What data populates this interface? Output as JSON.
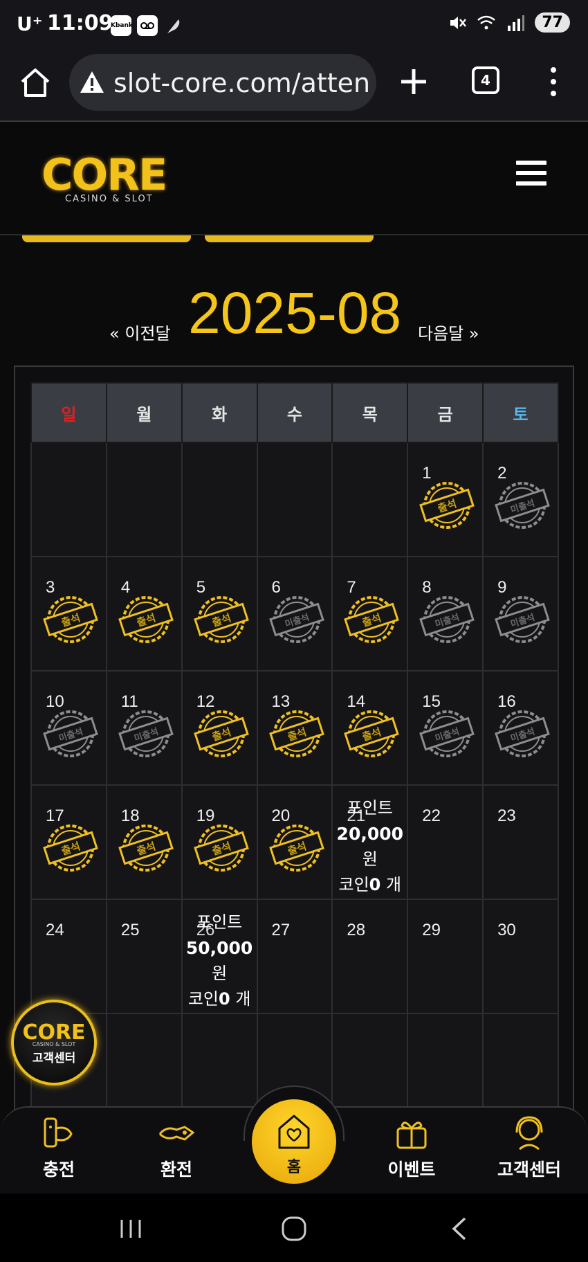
{
  "status_bar": {
    "carrier": "U⁺",
    "time": "11:09",
    "app_icon_1": "Kbank",
    "app_icon_2": "voicemail-icon",
    "app_icon_3": "feather-icon",
    "battery": "77"
  },
  "browser": {
    "url": "slot-core.com/attenda",
    "tab_count": "4"
  },
  "site": {
    "logo_text": "CORE",
    "logo_sub": "CASINO & SLOT"
  },
  "calendar": {
    "prev_label": "« 이전달",
    "title": "2025-08",
    "next_label": "다음달 »",
    "weekdays": [
      "일",
      "월",
      "화",
      "수",
      "목",
      "금",
      "토"
    ],
    "stamp_attended": "출석",
    "stamp_absent": "미출석",
    "reward_21": {
      "label": "포인트",
      "amount": "20,000",
      "unit": "원",
      "coin_prefix": "코인",
      "coin_value": "0",
      "coin_suffix": " 개"
    },
    "reward_26": {
      "label": "포인트",
      "amount": "50,000",
      "unit": "원",
      "coin_prefix": "코인",
      "coin_value": "0",
      "coin_suffix": " 개"
    },
    "weeks": [
      [
        null,
        null,
        null,
        null,
        null,
        {
          "day": "1",
          "stamp": "attended"
        },
        {
          "day": "2",
          "stamp": "absent"
        }
      ],
      [
        {
          "day": "3",
          "stamp": "attended"
        },
        {
          "day": "4",
          "stamp": "attended"
        },
        {
          "day": "5",
          "stamp": "attended"
        },
        {
          "day": "6",
          "stamp": "absent"
        },
        {
          "day": "7",
          "stamp": "attended"
        },
        {
          "day": "8",
          "stamp": "absent"
        },
        {
          "day": "9",
          "stamp": "absent"
        }
      ],
      [
        {
          "day": "10",
          "stamp": "absent"
        },
        {
          "day": "11",
          "stamp": "absent"
        },
        {
          "day": "12",
          "stamp": "attended"
        },
        {
          "day": "13",
          "stamp": "attended"
        },
        {
          "day": "14",
          "stamp": "attended"
        },
        {
          "day": "15",
          "stamp": "absent"
        },
        {
          "day": "16",
          "stamp": "absent"
        }
      ],
      [
        {
          "day": "17",
          "stamp": "attended"
        },
        {
          "day": "18",
          "stamp": "attended"
        },
        {
          "day": "19",
          "stamp": "attended"
        },
        {
          "day": "20",
          "stamp": "attended"
        },
        {
          "day": "21",
          "stamp": "reward_21"
        },
        {
          "day": "22",
          "stamp": ""
        },
        {
          "day": "23",
          "stamp": ""
        }
      ],
      [
        {
          "day": "24",
          "stamp": ""
        },
        {
          "day": "25",
          "stamp": ""
        },
        {
          "day": "26",
          "stamp": "reward_26"
        },
        {
          "day": "27",
          "stamp": ""
        },
        {
          "day": "28",
          "stamp": ""
        },
        {
          "day": "29",
          "stamp": ""
        },
        {
          "day": "30",
          "stamp": ""
        }
      ],
      [
        null,
        null,
        null,
        null,
        null,
        null,
        null
      ]
    ]
  },
  "cs_badge": {
    "logo": "CORE",
    "sub": "CASINO & SLOT",
    "label": "고객센터"
  },
  "bottom_nav": {
    "deposit": "충전",
    "withdraw": "환전",
    "home": "홈",
    "event": "이벤트",
    "support": "고객센터"
  },
  "colors": {
    "accent": "#f5c518",
    "sunday": "#e0201f",
    "saturday": "#5bb8f0",
    "header_bg": "#3b3d44"
  }
}
